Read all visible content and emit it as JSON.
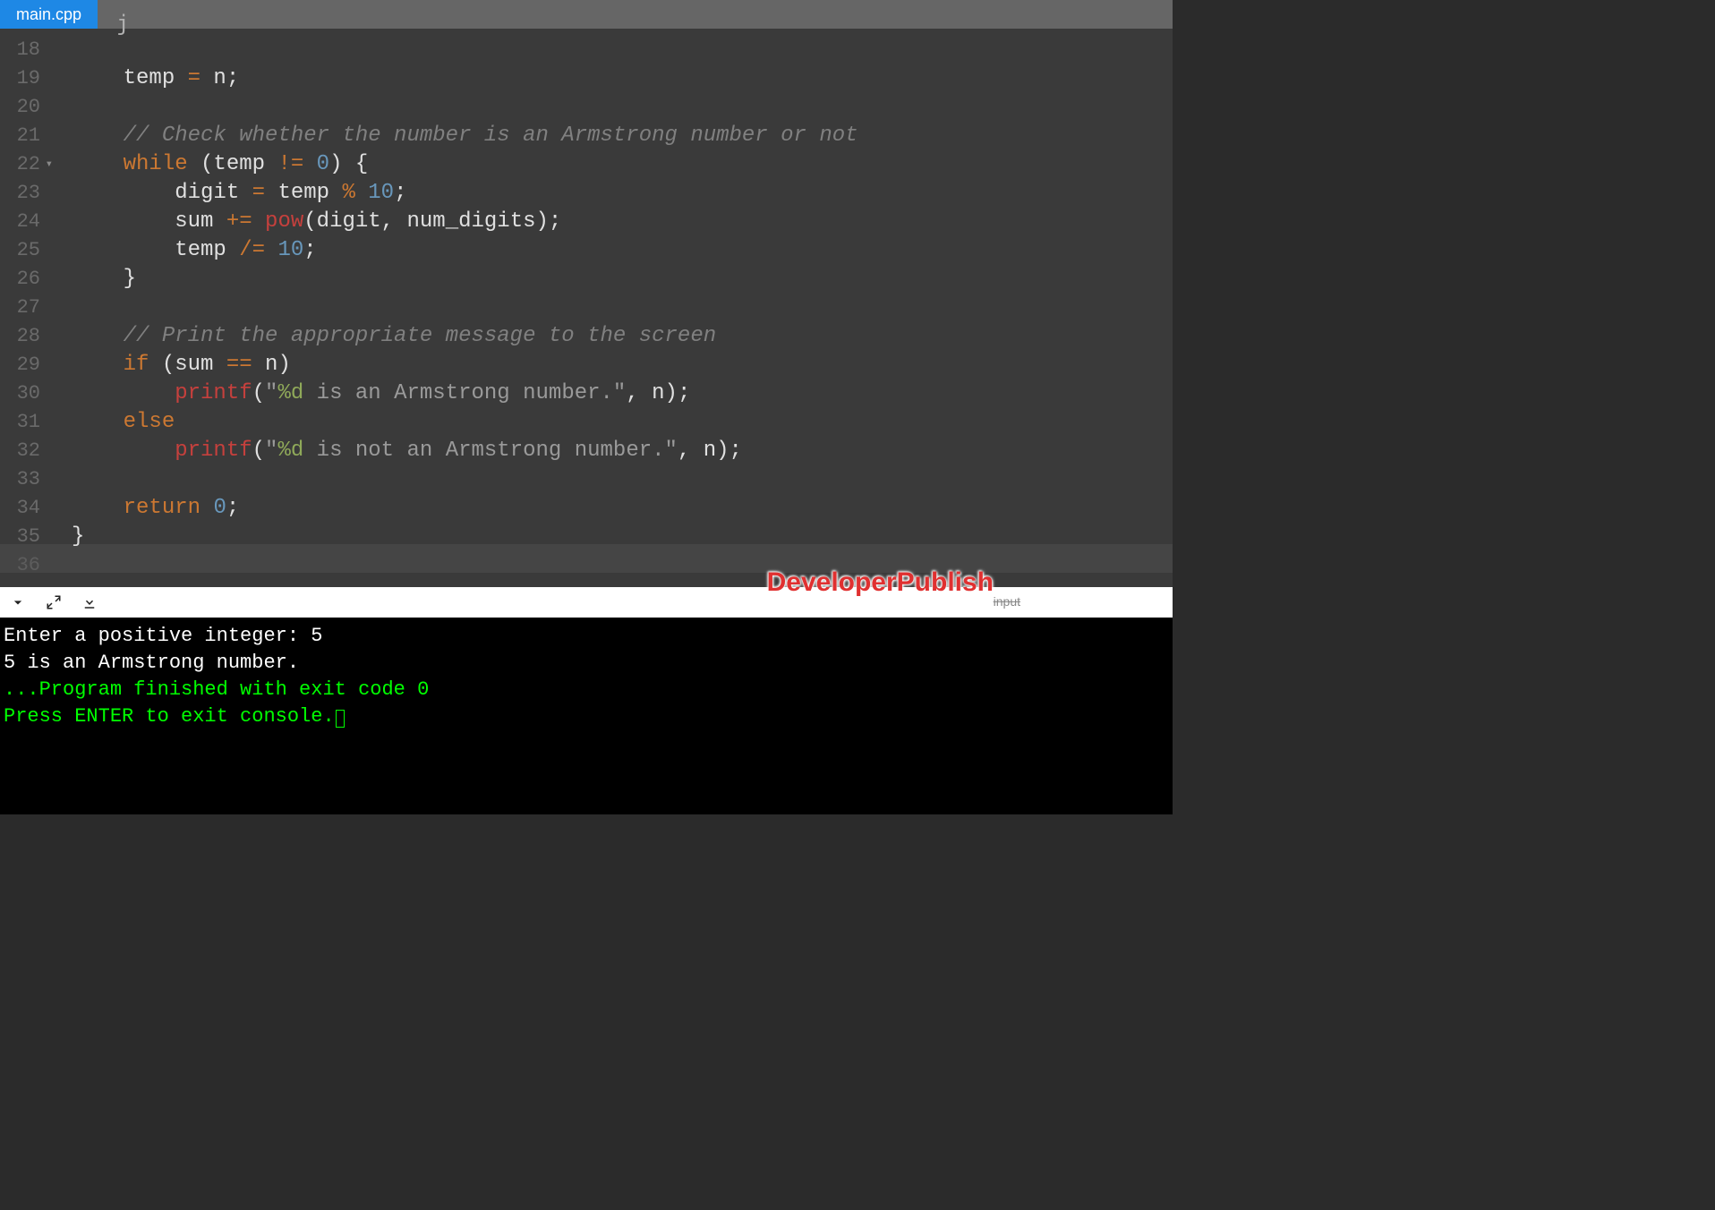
{
  "tab": {
    "label": "main.cpp"
  },
  "gutter": {
    "start": 18,
    "end": 36,
    "fold_lines": [
      22
    ]
  },
  "partial_top_char": "j",
  "code_lines": [
    {
      "n": 18,
      "tokens": []
    },
    {
      "n": 19,
      "tokens": [
        [
          "id",
          "    temp "
        ],
        [
          "op",
          "="
        ],
        [
          "id",
          " n"
        ],
        [
          "id",
          ";"
        ]
      ]
    },
    {
      "n": 20,
      "tokens": []
    },
    {
      "n": 21,
      "tokens": [
        [
          "com",
          "    // Check whether the number is an Armstrong number or not"
        ]
      ]
    },
    {
      "n": 22,
      "tokens": [
        [
          "id",
          "    "
        ],
        [
          "kw",
          "while"
        ],
        [
          "id",
          " (temp "
        ],
        [
          "op",
          "!="
        ],
        [
          "id",
          " "
        ],
        [
          "num",
          "0"
        ],
        [
          "id",
          ") {"
        ]
      ]
    },
    {
      "n": 23,
      "tokens": [
        [
          "id",
          "        digit "
        ],
        [
          "op",
          "="
        ],
        [
          "id",
          " temp "
        ],
        [
          "op",
          "%"
        ],
        [
          "id",
          " "
        ],
        [
          "num",
          "10"
        ],
        [
          "id",
          ";"
        ]
      ]
    },
    {
      "n": 24,
      "tokens": [
        [
          "id",
          "        sum "
        ],
        [
          "op",
          "+="
        ],
        [
          "id",
          " "
        ],
        [
          "fn",
          "pow"
        ],
        [
          "id",
          "(digit, num_digits);"
        ]
      ]
    },
    {
      "n": 25,
      "tokens": [
        [
          "id",
          "        temp "
        ],
        [
          "op",
          "/="
        ],
        [
          "id",
          " "
        ],
        [
          "num",
          "10"
        ],
        [
          "id",
          ";"
        ]
      ]
    },
    {
      "n": 26,
      "tokens": [
        [
          "id",
          "    }"
        ]
      ]
    },
    {
      "n": 27,
      "tokens": []
    },
    {
      "n": 28,
      "tokens": [
        [
          "com",
          "    // Print the appropriate message to the screen"
        ]
      ]
    },
    {
      "n": 29,
      "tokens": [
        [
          "id",
          "    "
        ],
        [
          "kw",
          "if"
        ],
        [
          "id",
          " (sum "
        ],
        [
          "op",
          "=="
        ],
        [
          "id",
          " n)"
        ]
      ]
    },
    {
      "n": 30,
      "tokens": [
        [
          "id",
          "        "
        ],
        [
          "fn",
          "printf"
        ],
        [
          "id",
          "("
        ],
        [
          "str",
          "\""
        ],
        [
          "fmt",
          "%d"
        ],
        [
          "str",
          " is an Armstrong number.\""
        ],
        [
          "id",
          ", n);"
        ]
      ]
    },
    {
      "n": 31,
      "tokens": [
        [
          "id",
          "    "
        ],
        [
          "kw",
          "else"
        ]
      ]
    },
    {
      "n": 32,
      "tokens": [
        [
          "id",
          "        "
        ],
        [
          "fn",
          "printf"
        ],
        [
          "id",
          "("
        ],
        [
          "str",
          "\""
        ],
        [
          "fmt",
          "%d"
        ],
        [
          "str",
          " is not an Armstrong number.\""
        ],
        [
          "id",
          ", n);"
        ]
      ]
    },
    {
      "n": 33,
      "tokens": []
    },
    {
      "n": 34,
      "tokens": [
        [
          "id",
          "    "
        ],
        [
          "kw",
          "return"
        ],
        [
          "id",
          " "
        ],
        [
          "num",
          "0"
        ],
        [
          "id",
          ";"
        ]
      ]
    },
    {
      "n": 35,
      "tokens": [
        [
          "id",
          "}"
        ]
      ]
    },
    {
      "n": 36,
      "tokens": [],
      "active": true
    }
  ],
  "watermark": "DeveloperPublish",
  "watermark_small": "input",
  "console": {
    "lines": [
      {
        "cls": "out-white",
        "text": "Enter a positive integer: 5"
      },
      {
        "cls": "out-white",
        "text": "5 is an Armstrong number."
      },
      {
        "cls": "out-white",
        "text": ""
      },
      {
        "cls": "out-green",
        "text": "...Program finished with exit code 0"
      },
      {
        "cls": "out-green",
        "text": "Press ENTER to exit console.",
        "cursor": true
      }
    ]
  },
  "icons": {
    "chevron_down": "chevron-down-icon",
    "expand": "expand-icon",
    "download": "download-icon"
  }
}
